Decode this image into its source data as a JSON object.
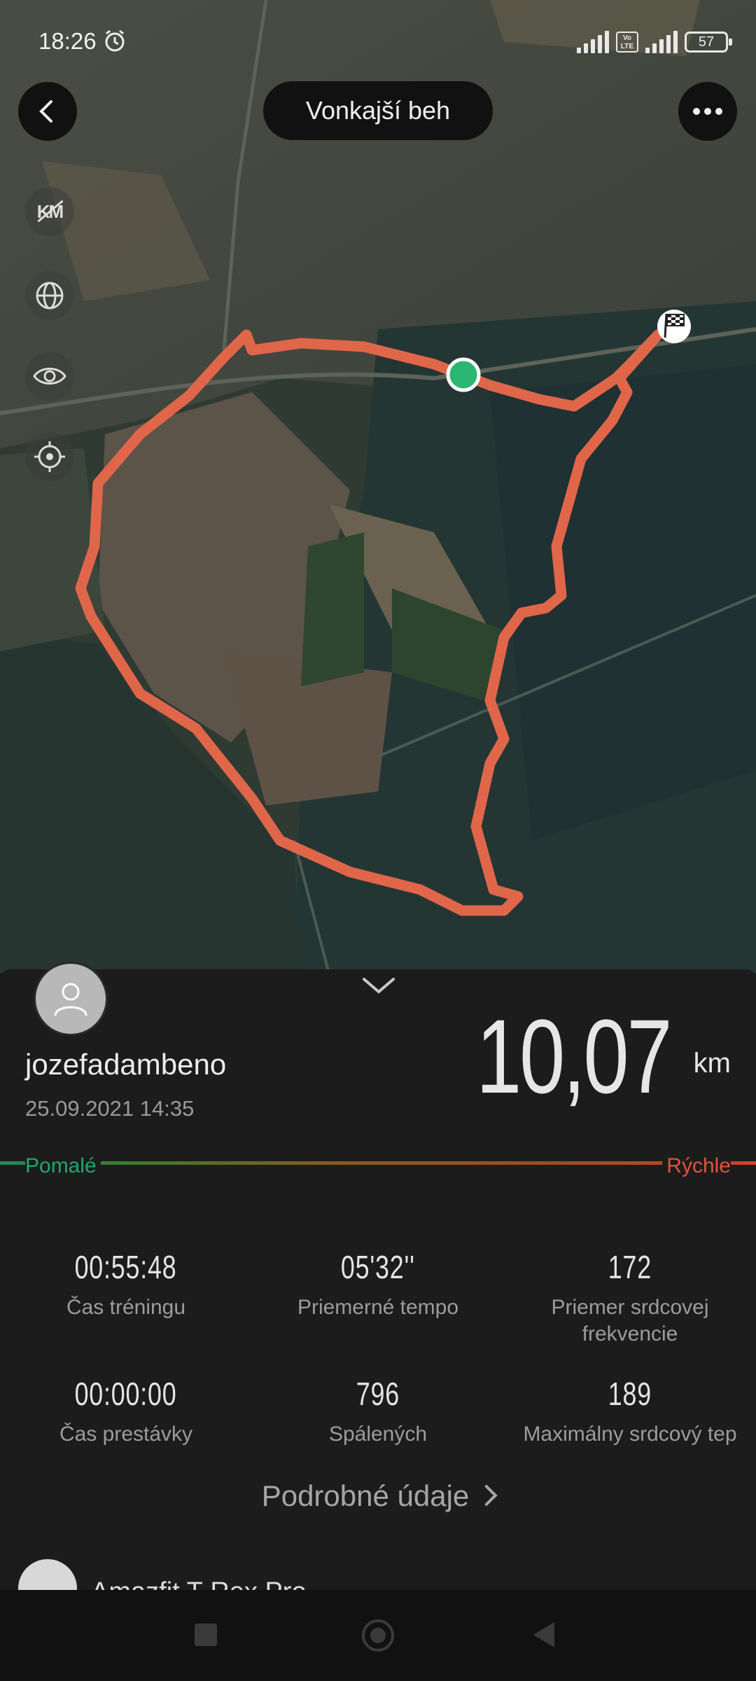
{
  "status_bar": {
    "time": "18:26",
    "alarm_icon": "alarm-icon",
    "volte_label": "Vo LTE",
    "battery": "57"
  },
  "header": {
    "title": "Vonkajší beh",
    "back_icon": "chevron-left-icon",
    "more_icon": "more-horizontal-icon"
  },
  "map_tools": [
    {
      "name": "km-toggle-icon"
    },
    {
      "name": "globe-icon"
    },
    {
      "name": "eye-icon"
    },
    {
      "name": "locate-icon"
    }
  ],
  "map": {
    "route_color": "#e0664a",
    "start_marker_color": "#2bb673",
    "finish_marker_icon": "checkered-flag-icon"
  },
  "workout": {
    "username": "jozefadambeno",
    "datetime": "25.09.2021 14:35",
    "distance": "10,07",
    "distance_unit": "km"
  },
  "pace_legend": {
    "slow": "Pomalé",
    "fast": "Rýchle"
  },
  "stats": [
    {
      "value": "00:55:48",
      "label": "Čas tréningu"
    },
    {
      "value": "05'32''",
      "label": "Priemerné tempo"
    },
    {
      "value": "172",
      "label": "Priemer srdcovej frekvencie"
    },
    {
      "value": "00:00:00",
      "label": "Čas prestávky"
    },
    {
      "value": "796",
      "label": "Spálených"
    },
    {
      "value": "189",
      "label": "Maximálny srdcový tep"
    }
  ],
  "details_link": "Podrobné údaje",
  "device": {
    "name": "Amazfit T-Rex Pro"
  }
}
